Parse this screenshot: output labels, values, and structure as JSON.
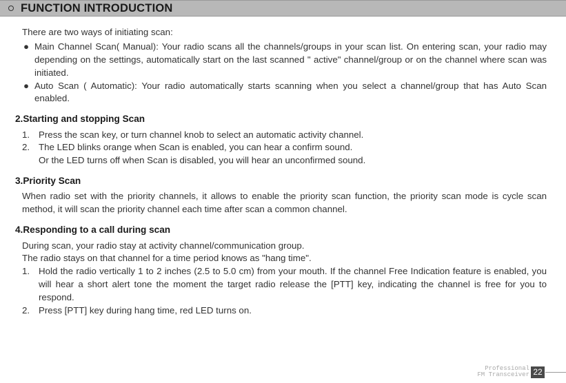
{
  "header": {
    "title": "FUNCTION INTRODUCTION"
  },
  "intro": "There are two ways of initiating scan:",
  "bullets": [
    "Main Channel Scan( Manual): Your radio scans all the channels/groups in your scan list. On entering scan, your radio may depending on the settings, automatically start on the last scanned \" active\" channel/group or on the channel where scan was initiated.",
    "Auto Scan ( Automatic): Your radio automatically starts scanning when you select a channel/group that has Auto Scan enabled."
  ],
  "s2": {
    "title": "2.Starting and stopping Scan",
    "items": [
      {
        "n": "1.",
        "t": "Press the scan key, or turn channel knob to select an automatic activity channel."
      },
      {
        "n": "2.",
        "t": "The LED blinks orange when Scan is enabled, you can hear a confirm sound."
      }
    ],
    "extra": "Or the LED turns off when Scan is disabled, you will hear an unconfirmed sound."
  },
  "s3": {
    "title": "3.Priority Scan",
    "body": "When radio set with the priority channels, it allows to enable the priority scan function, the priority scan mode is cycle scan method,  it will scan the priority channel each time after scan a common channel."
  },
  "s4": {
    "title": "4.Responding to a call during scan",
    "p1": "During scan, your radio stay at activity channel/communication group.",
    "p2": "The radio stays on that channel for a time period knows as \"hang time\".",
    "items": [
      {
        "n": "1.",
        "t": "Hold the radio vertically 1 to 2 inches (2.5 to 5.0 cm) from your mouth. If the channel Free Indication feature is enabled, you will hear a short alert tone the moment the target radio release the [PTT] key, indicating the channel is free for you to respond."
      },
      {
        "n": "2.",
        "t": "Press [PTT] key during hang time, red LED turns on."
      }
    ]
  },
  "footer": {
    "l1": "Professional",
    "l2": "FM Transceiver",
    "page": "22"
  }
}
